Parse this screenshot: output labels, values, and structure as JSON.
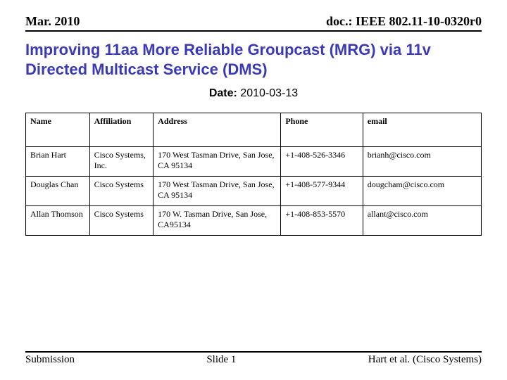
{
  "header": {
    "left": "Mar. 2010",
    "right": "doc.: IEEE 802.11-10-0320r0"
  },
  "title": "Improving 11aa More Reliable Groupcast (MRG) via 11v Directed Multicast Service (DMS)",
  "date": {
    "label": "Date:",
    "value": "2010-03-13"
  },
  "table": {
    "headers": [
      "Name",
      "Affiliation",
      "Address",
      "Phone",
      "email"
    ],
    "rows": [
      {
        "name": "Brian Hart",
        "affiliation": "Cisco Systems, Inc.",
        "address": "170 West Tasman Drive, San Jose, CA 95134",
        "phone": "+1-408-526-3346",
        "email": "brianh@cisco.com"
      },
      {
        "name": "Douglas Chan",
        "affiliation": "Cisco Systems",
        "address": "170 West Tasman Drive, San Jose, CA 95134",
        "phone": "+1-408-577-9344",
        "email": "dougcham@cisco.com"
      },
      {
        "name": "Allan Thomson",
        "affiliation": "Cisco Systems",
        "address": "170 W. Tasman Drive, San Jose, CA95134",
        "phone": "+1-408-853-5570",
        "email": "allant@cisco.com"
      }
    ]
  },
  "footer": {
    "left": "Submission",
    "center": "Slide 1",
    "right": "Hart et al. (Cisco Systems)"
  }
}
